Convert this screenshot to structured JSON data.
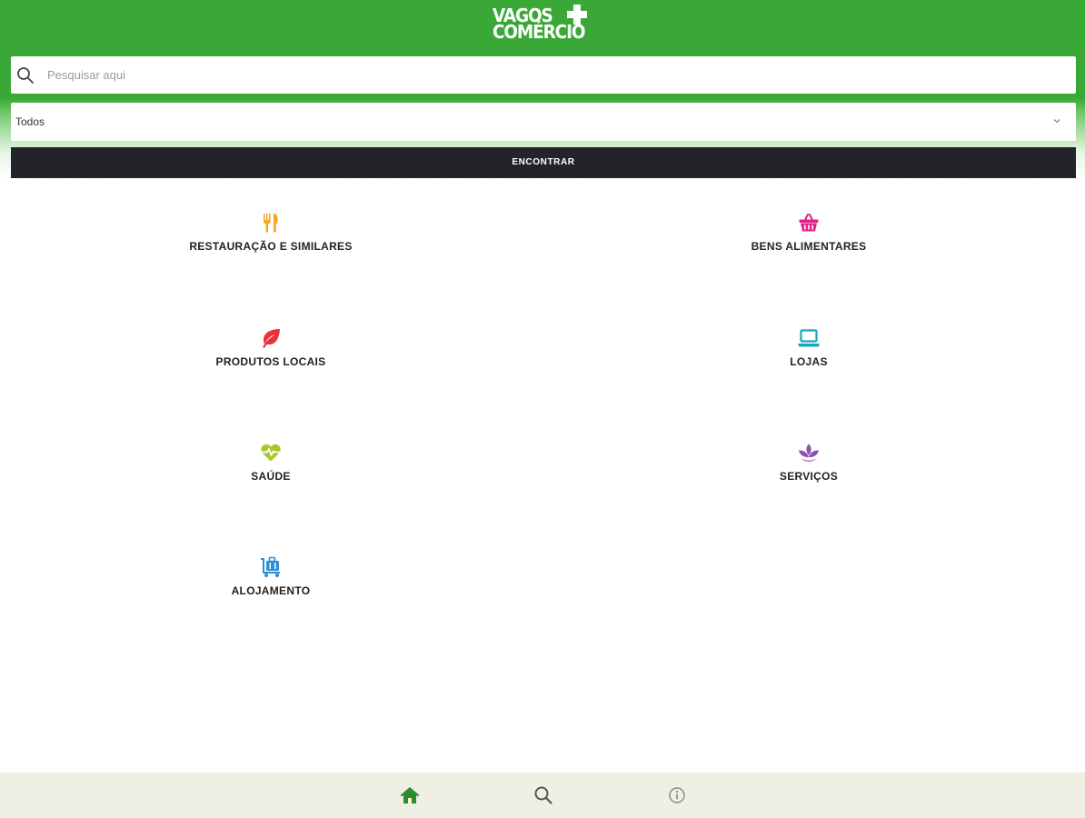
{
  "header": {
    "logo_line_1": "VAGOS",
    "logo_line_2": "COMÉRCIO",
    "bar_color": "#3aa836"
  },
  "search": {
    "placeholder": "Pesquisar aqui",
    "value": "",
    "icon": "search-icon"
  },
  "filter": {
    "selected": "Todos",
    "icon": "chevron-down-icon"
  },
  "find_button": {
    "label": "ENCONTRAR",
    "color": "#222429"
  },
  "categories": [
    {
      "label": "RESTAURAÇÃO E SIMILARES",
      "icon": "cutlery-icon",
      "color": "#f5a623"
    },
    {
      "label": "BENS ALIMENTARES",
      "icon": "basket-icon",
      "color": "#e0218a"
    },
    {
      "label": "PRODUTOS LOCAIS",
      "icon": "leaf-icon",
      "color": "#e8323c"
    },
    {
      "label": "LOJAS",
      "icon": "laptop-icon",
      "color": "#1aa7b8"
    },
    {
      "label": "SAÚDE",
      "icon": "heartbeat-icon",
      "color": "#a5c82c"
    },
    {
      "label": "SERVIÇOS",
      "icon": "lotus-icon",
      "color": "#8e4fb0"
    },
    {
      "label": "ALOJAMENTO",
      "icon": "luggage-cart-icon",
      "color": "#2a8fd6"
    }
  ],
  "bottom_nav": {
    "items": [
      {
        "name": "home",
        "icon": "home-icon",
        "active": true,
        "color": "#2e8b2e"
      },
      {
        "name": "search",
        "icon": "search-icon",
        "active": false,
        "color": "#555555"
      },
      {
        "name": "info",
        "icon": "info-icon",
        "active": false,
        "color": "#888888"
      }
    ]
  }
}
